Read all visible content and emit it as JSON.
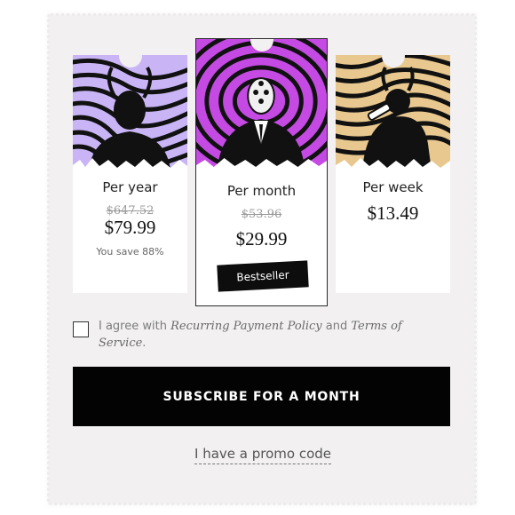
{
  "plans": {
    "year": {
      "label": "Per year",
      "old_price": "$647.52",
      "price": "$79.99",
      "save": "You save 88%",
      "accent": "#c9b5f5"
    },
    "month": {
      "label": "Per month",
      "old_price": "$53.96",
      "price": "$29.99",
      "badge": "Bestseller",
      "accent": "#c54ae4"
    },
    "week": {
      "label": "Per week",
      "price": "$13.49",
      "accent": "#e8c88f"
    }
  },
  "agreement": {
    "prefix": "I agree with ",
    "policy_link": "Recurring Payment Policy",
    "middle": " and ",
    "terms_link": "Terms of Service",
    "suffix": "."
  },
  "subscribe_label": "SUBSCRIBE FOR A MONTH",
  "promo_label": "I have a promo code"
}
